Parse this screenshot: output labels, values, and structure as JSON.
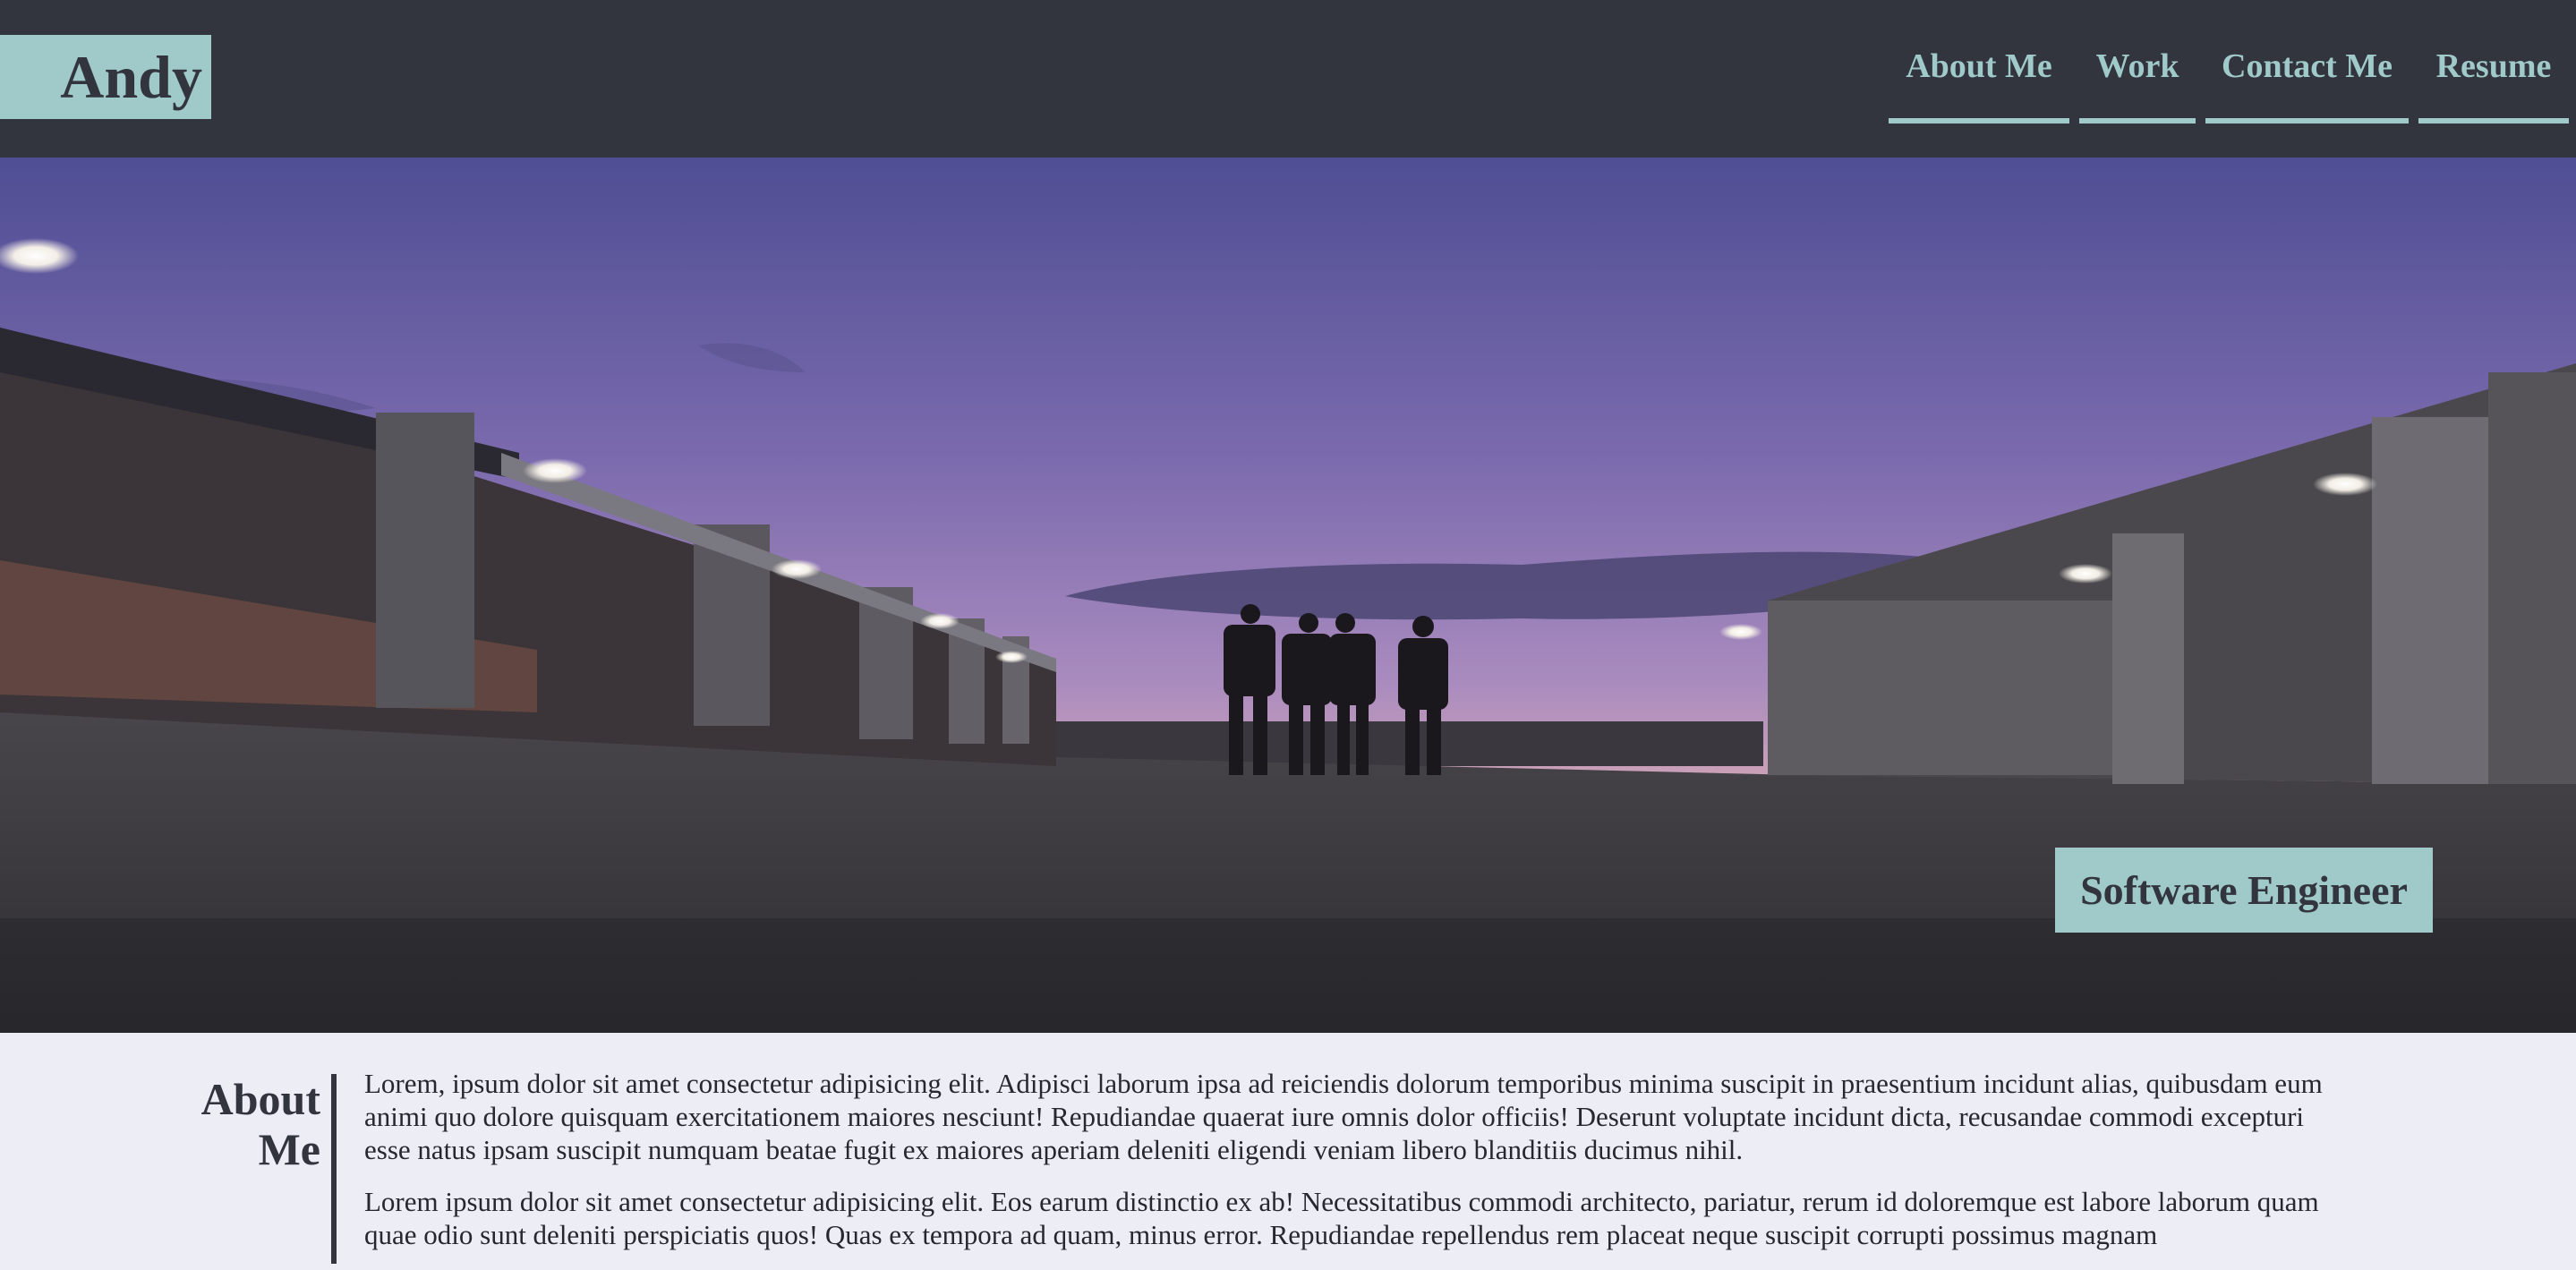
{
  "header": {
    "logo_text": "Andy",
    "nav": [
      {
        "label": "About Me"
      },
      {
        "label": "Work"
      },
      {
        "label": "Contact Me"
      },
      {
        "label": "Resume"
      }
    ]
  },
  "hero": {
    "image_description_icon": "rooftop-parking-dusk-photo",
    "role": "Software Engineer"
  },
  "about": {
    "heading_line1": "About",
    "heading_line2": "Me",
    "paragraphs": [
      "Lorem, ipsum dolor sit amet consectetur adipisicing elit. Adipisci laborum ipsa ad reiciendis dolorum temporibus minima suscipit in praesentium incidunt alias, quibusdam eum animi quo dolore quisquam exercitationem maiores nesciunt! Repudiandae quaerat iure omnis dolor officiis! Deserunt voluptate incidunt dicta, recusandae commodi excepturi esse natus ipsam suscipit numquam beatae fugit ex maiores aperiam deleniti eligendi veniam libero blanditiis ducimus nihil.",
      "Lorem ipsum dolor sit amet consectetur adipisicing elit. Eos earum distinctio ex ab! Necessitatibus commodi architecto, pariatur, rerum id doloremque est labore laborum quam quae odio sunt deleniti perspiciatis quos! Quas ex tempora ad quam, minus error. Repudiandae repellendus rem placeat neque suscipit corrupti possimus magnam"
    ]
  },
  "colors": {
    "header_bg": "#32353D",
    "accent": "#A0C9C9",
    "page_bg": "#ECEDF5"
  }
}
